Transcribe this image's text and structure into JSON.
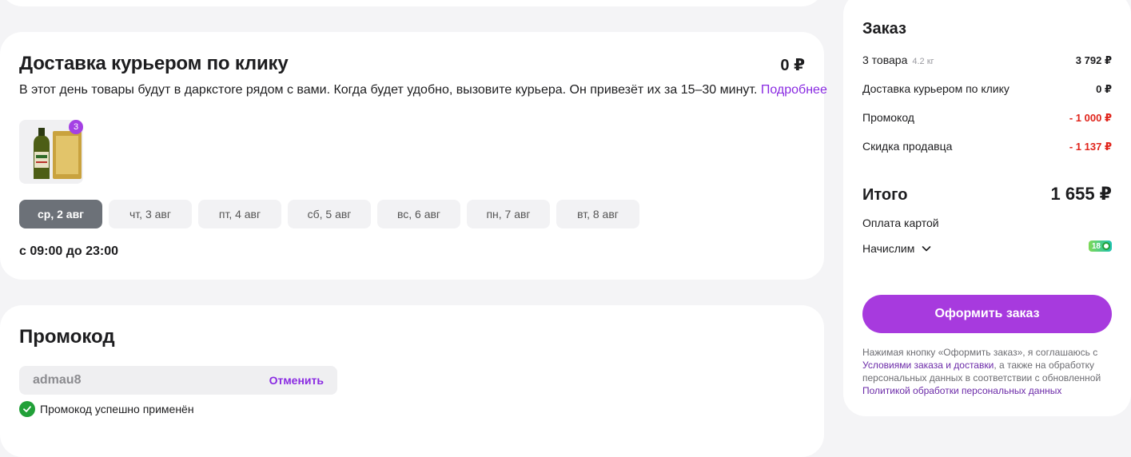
{
  "delivery": {
    "title": "Доставка курьером по клику",
    "price": "0 ₽",
    "description": "В этот день товары будут в даркстore рядом с вами. Когда будет удобно, вызовите курьера. Он привезёт их за 15–30 минут.",
    "more_link": "Подробнее",
    "product_qty": "3",
    "dates": [
      {
        "label": "ср, 2 авг",
        "active": true
      },
      {
        "label": "чт, 3 авг",
        "active": false
      },
      {
        "label": "пт, 4 авг",
        "active": false
      },
      {
        "label": "сб, 5 авг",
        "active": false
      },
      {
        "label": "вс, 6 авг",
        "active": false
      },
      {
        "label": "пн, 7 авг",
        "active": false
      },
      {
        "label": "вт, 8 авг",
        "active": false
      }
    ],
    "time_range": "с 09:00 до 23:00"
  },
  "promo": {
    "title": "Промокод",
    "code": "admau8",
    "cancel_label": "Отменить",
    "status": "Промокод успешно применён"
  },
  "order": {
    "title": "Заказ",
    "items_label": "3 товара",
    "items_weight": "4.2 кг",
    "items_value": "3 792 ₽",
    "delivery_label": "Доставка курьером по клику",
    "delivery_value": "0 ₽",
    "promo_label": "Промокод",
    "promo_value": "- 1 000 ₽",
    "discount_label": "Скидка продавца",
    "discount_value": "- 1 137 ₽",
    "total_label": "Итого",
    "total_value": "1 655 ₽",
    "payment_method": "Оплата картой",
    "accrual_label": "Начислим",
    "bonus_value": "18",
    "checkout_label": "Оформить заказ",
    "legal_prefix": "Нажимая кнопку «Оформить заказ», я соглашаюсь с",
    "legal_link1": "Условиями заказа и доставки",
    "legal_mid": ", а также на обработку персональных данных в соответствии с обновленной",
    "legal_link2": "Политикой обработки персональных данных"
  },
  "colors": {
    "accent": "#a73ade",
    "link": "#8a2be2",
    "negative": "#e0241b",
    "success": "#21a038"
  }
}
